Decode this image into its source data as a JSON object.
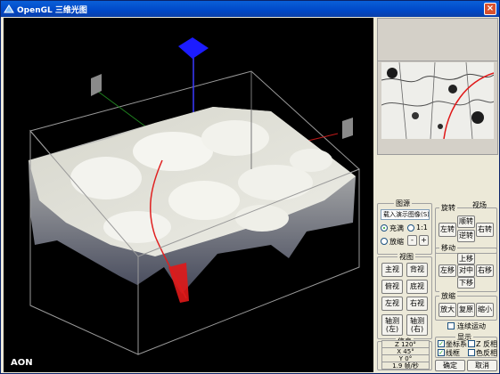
{
  "window": {
    "title": "OpenGL 三维光图",
    "close_label": "×"
  },
  "viewport": {
    "watermark": "AON"
  },
  "panel": {
    "image_group": {
      "title": "图源",
      "source_select": "载入演示图像(S)",
      "radio_fill": "充满",
      "radio_one_to_one": "1:1",
      "radio_zoom": "放缩",
      "zoom_minus": "-",
      "zoom_plus": "+"
    },
    "rotate_group": {
      "title": "旋转",
      "left_rotate": "左转",
      "cw_rotate": "顺转",
      "ccw_rotate": "逆转",
      "right_rotate": "右转"
    },
    "field_title": "视场",
    "move_group": {
      "title": "移动",
      "up": "上移",
      "left": "左移",
      "center": "对中",
      "right": "右移",
      "down": "下移"
    },
    "view_group": {
      "title": "视图",
      "main": "主视",
      "back": "背视",
      "top": "俯视",
      "bottom": "底视",
      "left": "左视",
      "right": "右视",
      "axo_left_1": "轴测",
      "axo_left_2": "(左)",
      "axo_right_1": "轴测",
      "axo_right_2": "(右)"
    },
    "scale_group": {
      "title": "放缩",
      "enlarge": "放大",
      "restore": "复原",
      "shrink": "缩小"
    },
    "continuous": "连续运动",
    "info_group": {
      "title": "信息",
      "z_value": "Z 120°",
      "x_value": "X 45°",
      "y_value": "Y 0°",
      "speed": "1.9 帧/秒"
    },
    "display_group": {
      "title": "显示",
      "coords": "坐标系",
      "z_reverse": "Z 反相",
      "wireframe": "线框",
      "color_reverse": "色反相"
    },
    "ok": "确定",
    "cancel": "取消"
  }
}
